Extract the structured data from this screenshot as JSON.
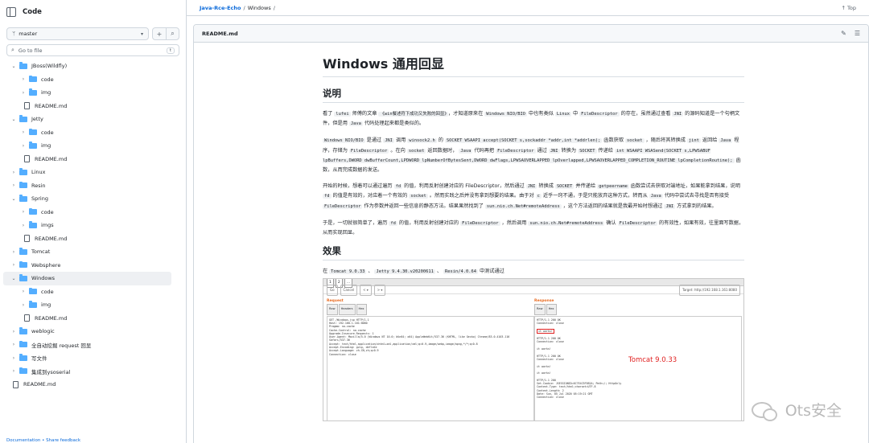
{
  "sidebar": {
    "title": "Code",
    "branch": "master",
    "add_label": "+",
    "search_label": "🔍",
    "goto_placeholder": "Go to file",
    "goto_kbd": "t",
    "tree": [
      {
        "label": "JBoss(Wildfly)"
      },
      {
        "label": "code"
      },
      {
        "label": "img"
      },
      {
        "label": "README.md"
      },
      {
        "label": "Jetty"
      },
      {
        "label": "code"
      },
      {
        "label": "img"
      },
      {
        "label": "README.md"
      },
      {
        "label": "Linux"
      },
      {
        "label": "Resin"
      },
      {
        "label": "Spring"
      },
      {
        "label": "code"
      },
      {
        "label": "imgs"
      },
      {
        "label": "README.md"
      },
      {
        "label": "Tomcat"
      },
      {
        "label": "Websphere"
      },
      {
        "label": "Windows"
      },
      {
        "label": "code"
      },
      {
        "label": "img"
      },
      {
        "label": "README.md"
      },
      {
        "label": "weblogic"
      },
      {
        "label": "全自动挖掘 request 回显"
      },
      {
        "label": "写文件"
      },
      {
        "label": "集成到ysoserial"
      },
      {
        "label": "README.md"
      }
    ],
    "footer": "Documentation • Share feedback"
  },
  "breadcrumb": {
    "repo": "Java-Rce-Echo",
    "sep": "/",
    "folder": "Windows",
    "trail": "/",
    "top_label": "↑ Top"
  },
  "file": {
    "name": "README.md",
    "edit_icon": "✎",
    "menu_icon": "☰"
  },
  "doc": {
    "h1": "Windows 通用回显",
    "h2_desc": "说明",
    "p1": {
      "a": "看了",
      "c1": "lufei",
      "b": "师傅的文章",
      "c2": "《win餐述符下成功又失败的回显》",
      "c": "，才知道原来在",
      "c3": "Windows NIO/BIO",
      "d": "中也有类似",
      "c4": "Linux",
      "e": "中",
      "c5": "FileDescriptor",
      "f": "的存在，虽然通过查看",
      "c6": "JNI",
      "g": "的源码知道是一个句柄文件，但是用",
      "c7": "Java",
      "h": "代码处理起来都是类似的。"
    },
    "p2": {
      "c1": "Windows NIO/BIO",
      "a": "是通过",
      "c2": "JNI",
      "b": "调用",
      "c3": "winsock2.h",
      "c": "的",
      "c4": "SOCKET WSAAPI accept(SOCKET s,sockaddr *addr,int *addrlen);",
      "d": "函数获取",
      "c5": "socket",
      "e": "，随后将其转换成",
      "c6": "jint",
      "f": "返回给",
      "c7": "Java",
      "g": "程序，存储为",
      "c8": "FileDescriptor",
      "h": "。在向",
      "c9": "socket",
      "i": "返回数据时，",
      "c10": "Java",
      "j": "代码再把",
      "c11": "FileDescriptor",
      "k": "通过",
      "c12": "JNI",
      "l": "转换为",
      "c13": "SOCKET",
      "m": "传递给",
      "c14": "int WSAAPI WSASend(SOCKET s,LPWSABUF lpBuffers,DWORD dwBufferCount,LPDWORD lpNumberOfBytesSent,DWORD dwFlags,LPWSAOVERLAPPED lpOverlapped,LPWSAOVERLAPPED_COMPLETION_ROUTINE lpCompletionRoutine);",
      "n": "函数，从而完成数据的发送。"
    },
    "p3": {
      "a": "开始的时候，想着可以通过遍历",
      "c1": "fd",
      "b": "的值，利用反射创建对应的 FileDescriptor，然后通过",
      "c2": "JNI",
      "c": "转换成",
      "c3": "SOCKET",
      "d": "并传递给",
      "c4": "getpeername",
      "e": "函数尝试去获取对端地址，如果能拿到结果，说明",
      "c5": "fd",
      "f": "的值是有效的，对应着一个有效的",
      "c6": "socket",
      "g": "。然而实践之后并没有拿到想要的结果。由于对",
      "c7": "c",
      "h": "近乎一窍不通，于是只能放弃这种方式，转而从",
      "c8": "Java",
      "i": "代码中尝试去寻找是否有接受",
      "c9": "FileDescriptor",
      "j": "作为参数并返回一些信息的静态方法。结果果然找到了",
      "c10": "sun.nio.ch.Net#remoteAddress",
      "k": "，这个方法返回的结果就是我最开始时想通过",
      "c11": "JNI",
      "l": "方式拿到的结果。"
    },
    "p4": {
      "a": "于是，一切就很简单了，遍历",
      "c1": "fd",
      "b": "的值，利用反射创建对应的",
      "c2": "FileDescriptor",
      "c": "，然后调用",
      "c3": "sun.nio.ch.Net#remoteAddress",
      "d": "确认",
      "c4": "FileDescriptor",
      "e": "的有效性，如果有效，往里面写数据，从而实现回显。"
    },
    "h2_effect": "效果",
    "p5": {
      "a": "在",
      "c1": "Tomcat 9.0.33",
      "b": "、",
      "c2": "Jetty 9.4.30.v20200611",
      "c": "、",
      "c3": "Resin/4.0.64",
      "d": "中测试通过"
    }
  },
  "screenshot": {
    "target": "Target: http://192.168.1.161:8080",
    "request_title": "Request",
    "response_title": "Response",
    "req_tabs": [
      "Raw",
      "Headers",
      "Hex"
    ],
    "resp_tabs": [
      "Raw",
      "Hex"
    ],
    "req_lines": [
      "GET /Windows.jsp HTTP/1.1",
      "Host: 192.168.1.161:8080",
      "Pragma: no-cache",
      "Cache-Control: no-cache",
      "Upgrade-Insecure-Requests: 1",
      "User-Agent: Mozilla/5.0 (Windows NT 10.0; Win64; x64) AppleWebKit/537.36 (KHTML, like Gecko) Chrome/83.0.4103.116 Safari/537.36",
      "Accept: text/html,application/xhtml+xml,application/xml;q=0.9,image/webp,image/apng,*/*;q=0.8",
      "Accept-Encoding: gzip, deflate",
      "Accept-Language: zh-CN,zh;q=0.9",
      "Connection: close"
    ],
    "resp_lines": [
      "HTTP/1.1 200 OK",
      "Connection: close",
      "",
      "it works!",
      "",
      "HTTP/1.1 200 OK",
      "Connection: close",
      "",
      "it works!",
      "",
      "HTTP/1.1 200 OK",
      "Connection: close",
      "",
      "it works!",
      "",
      "it works!",
      "",
      "HTTP/1.1 200",
      "Set-Cookie: JSESSIONID=6C7E4C3F5B2A; Path=/; HttpOnly",
      "Content-Type: text/html;charset=UTF-8",
      "Content-Length: 2",
      "Date: Sun, 05 Jul 2020 05:19:21 GMT",
      "Connection: close"
    ],
    "annotation": "Tomcat 9.0.33",
    "btn_go": "Go",
    "btn_cancel": "Cancel",
    "btn_back": "< ▾",
    "btn_fwd": "> ▾"
  },
  "watermark": {
    "text": "Ots安全"
  }
}
